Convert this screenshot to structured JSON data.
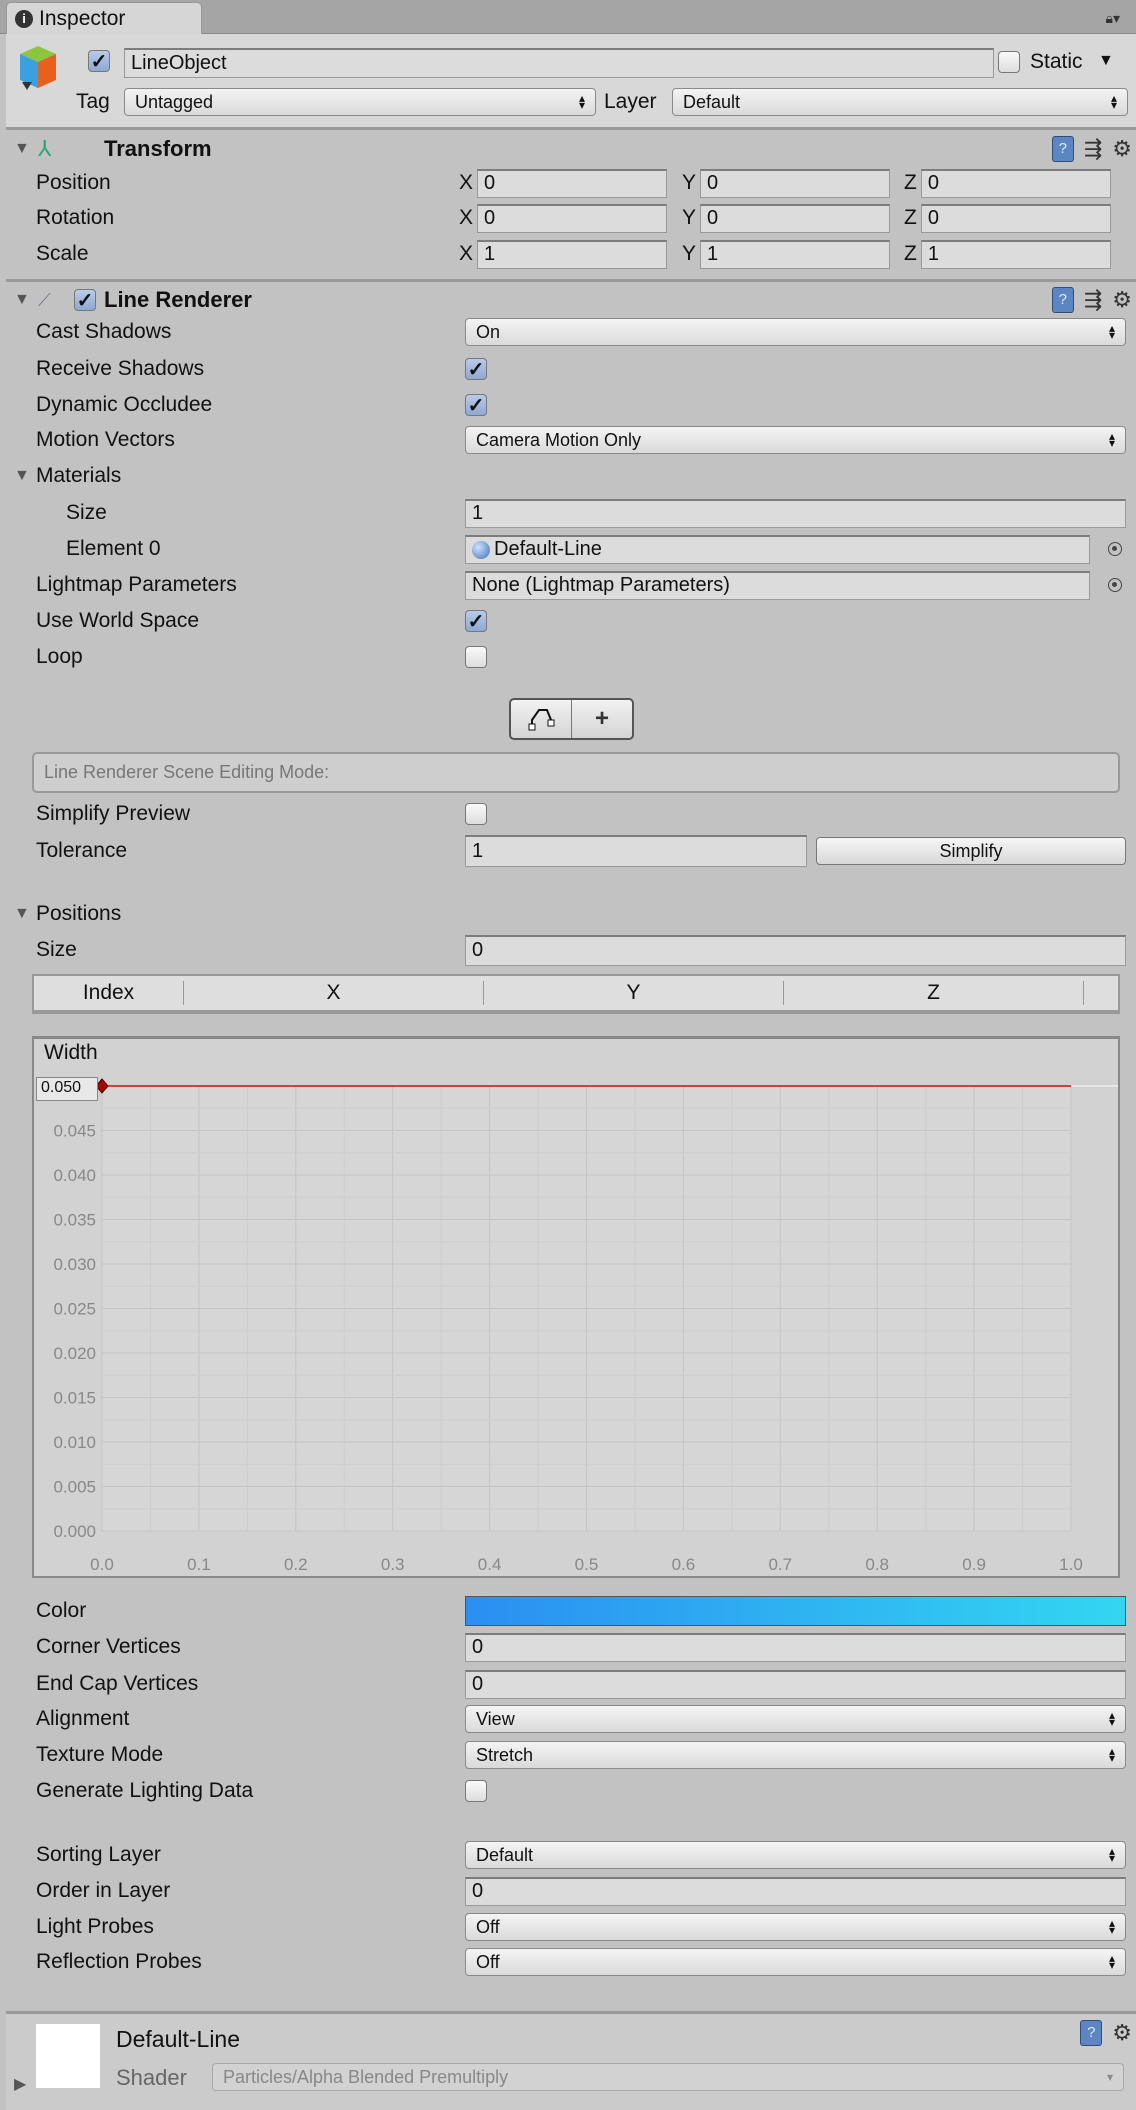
{
  "tab": {
    "title": "Inspector"
  },
  "object": {
    "name": "LineObject",
    "active": true,
    "static_label": "Static",
    "static": false,
    "tag_label": "Tag",
    "tag": "Untagged",
    "layer_label": "Layer",
    "layer": "Default"
  },
  "transform": {
    "title": "Transform",
    "rows": [
      {
        "label": "Position",
        "x": "0",
        "y": "0",
        "z": "0"
      },
      {
        "label": "Rotation",
        "x": "0",
        "y": "0",
        "z": "0"
      },
      {
        "label": "Scale",
        "x": "1",
        "y": "1",
        "z": "1"
      }
    ],
    "axis": {
      "x": "X",
      "y": "Y",
      "z": "Z"
    }
  },
  "line_renderer": {
    "title": "Line Renderer",
    "enabled": true,
    "cast_shadows": {
      "label": "Cast Shadows",
      "value": "On"
    },
    "receive_shadows": {
      "label": "Receive Shadows",
      "checked": true
    },
    "dynamic_occludee": {
      "label": "Dynamic Occludee",
      "checked": true
    },
    "motion_vectors": {
      "label": "Motion Vectors",
      "value": "Camera Motion Only"
    },
    "materials": {
      "label": "Materials",
      "size_label": "Size",
      "size": "1",
      "element0_label": "Element 0",
      "element0": "Default-Line"
    },
    "lightmap": {
      "label": "Lightmap Parameters",
      "value": "None (Lightmap Parameters)"
    },
    "use_world_space": {
      "label": "Use World Space",
      "checked": true
    },
    "loop": {
      "label": "Loop",
      "checked": false
    },
    "edit_mode_help": "Line Renderer Scene Editing Mode:",
    "simplify_preview": {
      "label": "Simplify Preview",
      "checked": false
    },
    "tolerance": {
      "label": "Tolerance",
      "value": "1",
      "button": "Simplify"
    },
    "positions": {
      "label": "Positions",
      "size_label": "Size",
      "size": "0",
      "columns": [
        "Index",
        "X",
        "Y",
        "Z"
      ]
    },
    "width_label": "Width",
    "width_value": "0.050",
    "color": {
      "label": "Color",
      "from": "#2a8ff2",
      "to": "#33d6f2"
    },
    "corner_vertices": {
      "label": "Corner Vertices",
      "value": "0"
    },
    "end_cap_vertices": {
      "label": "End Cap Vertices",
      "value": "0"
    },
    "alignment": {
      "label": "Alignment",
      "value": "View"
    },
    "texture_mode": {
      "label": "Texture Mode",
      "value": "Stretch"
    },
    "generate_lighting": {
      "label": "Generate Lighting Data",
      "checked": false
    },
    "sorting_layer": {
      "label": "Sorting Layer",
      "value": "Default"
    },
    "order_in_layer": {
      "label": "Order in Layer",
      "value": "0"
    },
    "light_probes": {
      "label": "Light Probes",
      "value": "Off"
    },
    "reflection_probes": {
      "label": "Reflection Probes",
      "value": "Off"
    }
  },
  "material": {
    "name": "Default-Line",
    "shader_label": "Shader",
    "shader": "Particles/Alpha Blended Premultiply"
  },
  "chart_data": {
    "type": "line",
    "title": "Width",
    "x": [
      0,
      1
    ],
    "y": [
      0.05,
      0.05
    ],
    "xlim": [
      0,
      1
    ],
    "ylim": [
      0,
      0.05
    ],
    "xticks": [
      "0.0",
      "0.1",
      "0.2",
      "0.3",
      "0.4",
      "0.5",
      "0.6",
      "0.7",
      "0.8",
      "0.9",
      "1.0"
    ],
    "yticks": [
      "0.000",
      "0.005",
      "0.010",
      "0.015",
      "0.020",
      "0.025",
      "0.030",
      "0.035",
      "0.040",
      "0.045",
      "0.050"
    ],
    "line_color": "#cc1111",
    "grid": true
  }
}
